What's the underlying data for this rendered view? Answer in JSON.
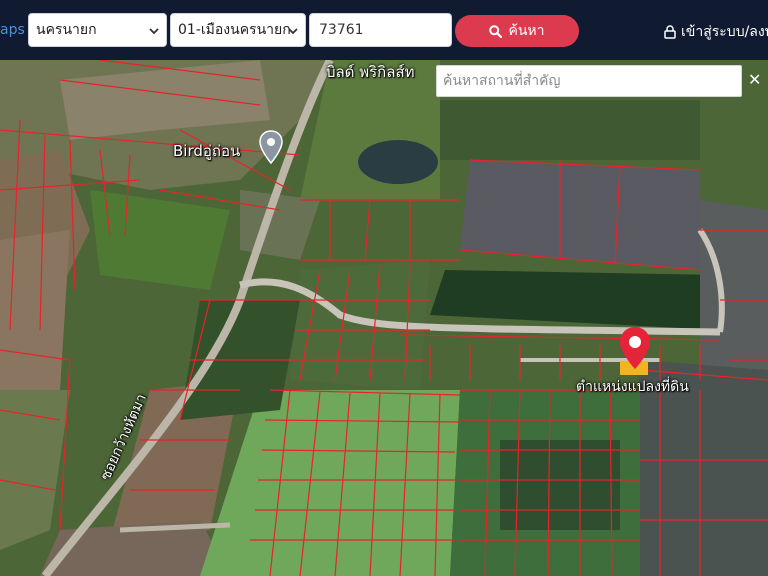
{
  "header": {
    "brand_fragment": "aps",
    "province_select": "นครนายก",
    "district_select": "01-เมืองนครนายก",
    "postcode_value": "73761",
    "search_button": "ค้นหา",
    "login_link": "เข้าสู่ระบบ/ลงท",
    "accent_color": "#dc3b4f",
    "bar_color": "#101a30"
  },
  "map": {
    "place_search_placeholder": "ค้นหาสถานที่สำคัญ",
    "close_glyph": "✕",
    "labels": {
      "place_bird": "Birdอู่ถ่อน",
      "village": "บิลด์ พริกิลส์ท",
      "road": "ซอยกว้างหัตมา",
      "plot_location": "ตำแหน่งแปลงที่ดิน"
    },
    "icons": {
      "place_pin": "map-pin-icon",
      "plot_marker": "location-marker-icon",
      "search": "magnifier-icon",
      "lock": "lock-icon"
    }
  }
}
